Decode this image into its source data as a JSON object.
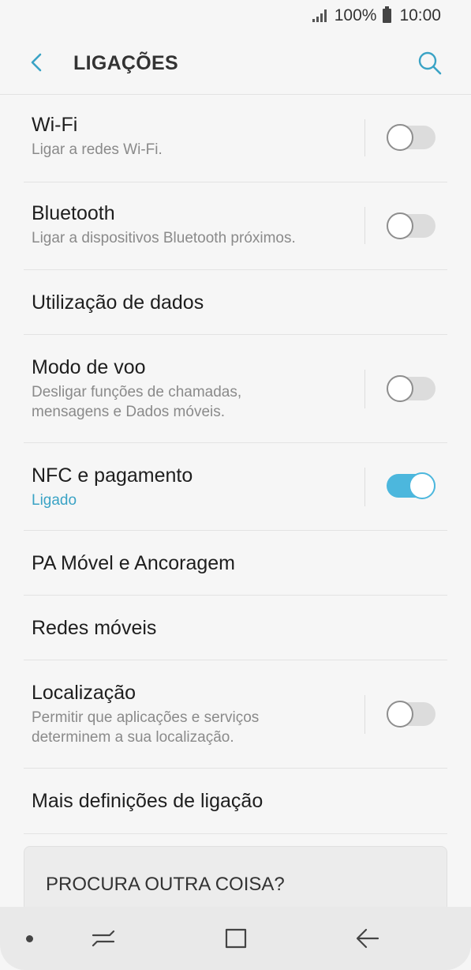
{
  "status_bar": {
    "battery": "100%",
    "time": "10:00"
  },
  "header": {
    "title": "LIGAÇÕES",
    "back_icon": "chevron-left-icon",
    "search_icon": "search-icon"
  },
  "colors": {
    "accent": "#4cb7dd",
    "active_text": "#3aa3c5",
    "background": "#f6f6f6"
  },
  "settings": [
    {
      "title": "Wi-Fi",
      "subtitle": "Ligar a redes Wi-Fi.",
      "has_toggle": true,
      "on": false
    },
    {
      "title": "Bluetooth",
      "subtitle": "Ligar a dispositivos Bluetooth próximos.",
      "has_toggle": true,
      "on": false
    },
    {
      "title": "Utilização de dados"
    },
    {
      "title": "Modo de voo",
      "subtitle": "Desligar funções de chamadas, mensagens e Dados móveis.",
      "has_toggle": true,
      "on": false
    },
    {
      "title": "NFC e pagamento",
      "subtitle": "Ligado",
      "has_toggle": true,
      "on": true
    },
    {
      "title": "PA Móvel e Ancoragem"
    },
    {
      "title": "Redes móveis"
    },
    {
      "title": "Localização",
      "subtitle": "Permitir que aplicações e serviços determinem a sua localização.",
      "has_toggle": true,
      "on": false
    },
    {
      "title": "Mais definições de ligação"
    }
  ],
  "suggestions": {
    "label": "PROCURA OUTRA COISA?"
  },
  "nav_bar": {
    "recents_icon": "recents-icon",
    "home_icon": "home-icon",
    "back_icon": "back-arrow-icon"
  }
}
